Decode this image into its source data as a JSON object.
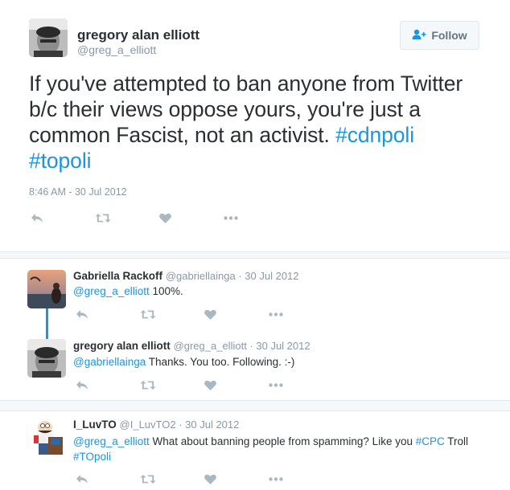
{
  "main_tweet": {
    "author_name": "gregory alan elliott",
    "author_handle": "@greg_a_elliott",
    "follow_label": "Follow",
    "text_part1": "If you've attempted to ban anyone from Twitter b/c their views oppose yours, you're just a common Fascist, not an activist. ",
    "hashtag1": "#cdnpoli",
    "hashtag2": "#topoli",
    "timestamp": "8:46 AM - 30 Jul 2012"
  },
  "replies": [
    {
      "name": "Gabriella Rackoff",
      "handle": "@gabriellainga",
      "date": "30 Jul 2012",
      "mention": "@greg_a_elliott",
      "text": " 100%."
    },
    {
      "name": "gregory alan elliott",
      "handle": "@greg_a_elliott",
      "date": "30 Jul 2012",
      "mention": "@gabriellainga",
      "text": " Thanks. You too. Following. :-)"
    },
    {
      "name": "I_LuvTO",
      "handle": "@I_LuvTO2",
      "date": "30 Jul 2012",
      "mention": "@greg_a_elliott",
      "text": " What about banning people from spamming? Like you ",
      "hashtag1": "#CPC",
      "text2": " Troll ",
      "hashtag2": "#TOpoli"
    }
  ],
  "meta_separator": " · ",
  "icons": {
    "reply": "reply-arrow-icon",
    "retweet": "retweet-icon",
    "like": "heart-icon",
    "more": "more-dots-icon",
    "follow": "add-user-icon"
  },
  "colors": {
    "link": "#1b95e0",
    "muted": "#8899a6",
    "text": "#292f33",
    "icon": "#aab8c2"
  }
}
